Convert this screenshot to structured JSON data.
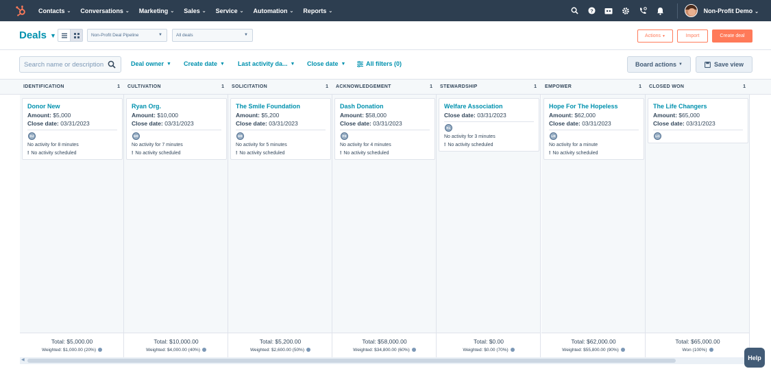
{
  "nav": {
    "items": [
      {
        "label": "Contacts"
      },
      {
        "label": "Conversations"
      },
      {
        "label": "Marketing"
      },
      {
        "label": "Sales"
      },
      {
        "label": "Service"
      },
      {
        "label": "Automation"
      },
      {
        "label": "Reports"
      }
    ],
    "account_label": "Non-Profit Demo",
    "icons": [
      "search-icon",
      "help-icon",
      "marketplace-icon",
      "settings-icon",
      "calling-icon",
      "notifications-icon"
    ]
  },
  "header": {
    "title": "Deals",
    "pipeline_select": "Non-Profit Deal Pipeline",
    "deals_filter_select": "All deals",
    "actions_label": "Actions",
    "import_label": "Import",
    "create_label": "Create deal"
  },
  "filters": {
    "search_placeholder": "Search name or description",
    "deal_owner": "Deal owner",
    "create_date": "Create date",
    "last_activity_date": "Last activity da...",
    "close_date": "Close date",
    "all_filters": "All filters (0)",
    "board_actions": "Board actions",
    "save_view": "Save view"
  },
  "stages": [
    {
      "name": "IDENTIFICATION",
      "count": "1",
      "card": {
        "deal": "Donor New",
        "amount_label": "Amount:",
        "amount": "$5,000",
        "close_label": "Close date:",
        "close": "03/31/2023",
        "owner": "DJ",
        "activity": "No activity for 8 minutes",
        "scheduled": "No activity scheduled"
      },
      "total": "Total: $5,000.00",
      "weighted": "Weighted: $1,000.00 (20%)"
    },
    {
      "name": "CULTIVATION",
      "count": "1",
      "card": {
        "deal": "Ryan Org.",
        "amount_label": "Amount:",
        "amount": "$10,000",
        "close_label": "Close date:",
        "close": "03/31/2023",
        "owner": "ER",
        "activity": "No activity for 7 minutes",
        "scheduled": "No activity scheduled"
      },
      "total": "Total: $10,000.00",
      "weighted": "Weighted: $4,000.00 (40%)"
    },
    {
      "name": "SOLICITATION",
      "count": "1",
      "card": {
        "deal": "The Smile Foundation",
        "amount_label": "Amount:",
        "amount": "$5,200",
        "close_label": "Close date:",
        "close": "03/31/2023",
        "owner": "ER",
        "activity": "No activity for 5 minutes",
        "scheduled": "No activity scheduled"
      },
      "total": "Total: $5,200.00",
      "weighted": "Weighted: $2,600.00 (50%)"
    },
    {
      "name": "ACKNOWLEDGEMENT",
      "count": "1",
      "card": {
        "deal": "Dash Donation",
        "amount_label": "Amount:",
        "amount": "$58,000",
        "close_label": "Close date:",
        "close": "03/31/2023",
        "owner": "FS",
        "activity": "No activity for 4 minutes",
        "scheduled": "No activity scheduled"
      },
      "total": "Total: $58,000.00",
      "weighted": "Weighted: $34,800.00 (60%)"
    },
    {
      "name": "STEWARDSHIP",
      "count": "1",
      "card": {
        "deal": "Welfare Association",
        "amount_label": "",
        "amount": "",
        "close_label": "Close date:",
        "close": "03/31/2023",
        "owner": "KL",
        "activity": "No activity for 3 minutes",
        "scheduled": "No activity scheduled"
      },
      "total": "Total: $0.00",
      "weighted": "Weighted: $0.00 (70%)"
    },
    {
      "name": "EMPOWER",
      "count": "1",
      "card": {
        "deal": "Hope For The Hopeless",
        "amount_label": "Amount:",
        "amount": "$62,000",
        "close_label": "Close date:",
        "close": "03/31/2023",
        "owner": "LR",
        "activity": "No activity for a minute",
        "scheduled": "No activity scheduled"
      },
      "total": "Total: $62,000.00",
      "weighted": "Weighted: $55,800.00 (90%)"
    },
    {
      "name": "CLOSED WON",
      "count": "1",
      "card": {
        "deal": "The Life Changers",
        "amount_label": "Amount:",
        "amount": "$65,000",
        "close_label": "Close date:",
        "close": "03/31/2023",
        "owner": "LG",
        "activity": "",
        "scheduled": ""
      },
      "total": "Total: $65,000.00",
      "weighted": "Won (100%)"
    }
  ],
  "help_label": "Help",
  "colors": {
    "nav_bg": "#2d3e50",
    "accent": "#0091ae",
    "brand": "#ff7a59"
  }
}
